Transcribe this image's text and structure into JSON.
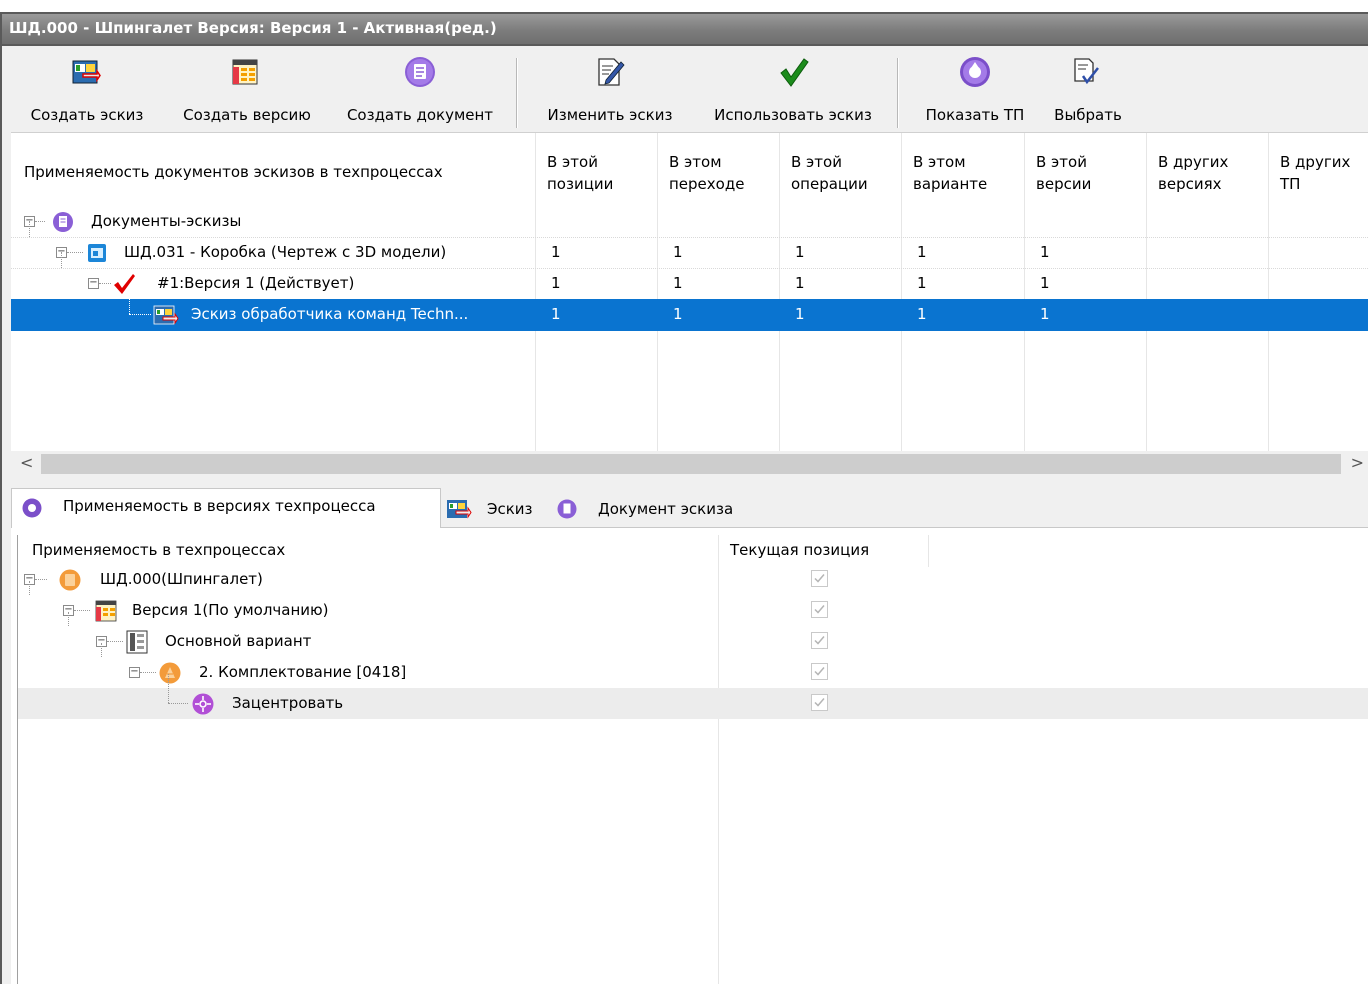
{
  "window": {
    "title": "ШД.000 - Шпингалет Версия: Версия 1 -  Активная(ред.)"
  },
  "toolbar": {
    "buttons": [
      {
        "label": "Создать эскиз",
        "icon": "sketch-create-icon"
      },
      {
        "label": "Создать версию",
        "icon": "version-create-icon"
      },
      {
        "label": "Создать документ",
        "icon": "document-create-icon"
      },
      {
        "label": "Изменить эскиз",
        "icon": "sketch-edit-icon"
      },
      {
        "label": "Использовать эскиз",
        "icon": "green-check-icon"
      },
      {
        "label": "Показать ТП",
        "icon": "show-tp-icon"
      },
      {
        "label": "Выбрать",
        "icon": "select-icon"
      }
    ]
  },
  "grid": {
    "columns": [
      "Применяемость документов эскизов в техпроцессах",
      "В этой\nпозиции",
      "В этом\nпереходе",
      "В этой\nоперации",
      "В этом\nварианте",
      "В этой\nверсии",
      "В других\nверсиях",
      "В других\nТП"
    ],
    "rows": [
      {
        "label": "Документы-эскизы",
        "values": [
          "",
          "",
          "",
          "",
          "",
          "",
          ""
        ]
      },
      {
        "label": "ШД.031 - Коробка (Чертеж с 3D модели)",
        "values": [
          "1",
          "1",
          "1",
          "1",
          "1",
          "",
          ""
        ]
      },
      {
        "label": "#1:Версия 1 (Действует)",
        "values": [
          "1",
          "1",
          "1",
          "1",
          "1",
          "",
          ""
        ]
      },
      {
        "label": "Эскиз обработчика команд Techn...",
        "values": [
          "1",
          "1",
          "1",
          "1",
          "1",
          "",
          ""
        ],
        "selected": true
      }
    ]
  },
  "tabs": [
    {
      "label": "Применяемость в версиях техпроцесса",
      "active": true
    },
    {
      "label": "Эскиз",
      "active": false
    },
    {
      "label": "Документ эскиза",
      "active": false
    }
  ],
  "bottom_grid": {
    "columns": [
      "Применяемость в техпроцессах",
      "Текущая позиция"
    ],
    "rows": [
      {
        "label": "ШД.000(Шпингалет)",
        "checked": true
      },
      {
        "label": "Версия 1(По умолчанию)",
        "checked": true
      },
      {
        "label": "Основной вариант",
        "checked": true
      },
      {
        "label": "2. Комплектование [0418]",
        "checked": true
      },
      {
        "label": "Зацентровать",
        "checked": true
      }
    ]
  },
  "colors": {
    "selection": "#0a74d0",
    "title_bar": "#7f7f7f",
    "check_red": "#e00000",
    "check_green": "#1c8c1c"
  }
}
